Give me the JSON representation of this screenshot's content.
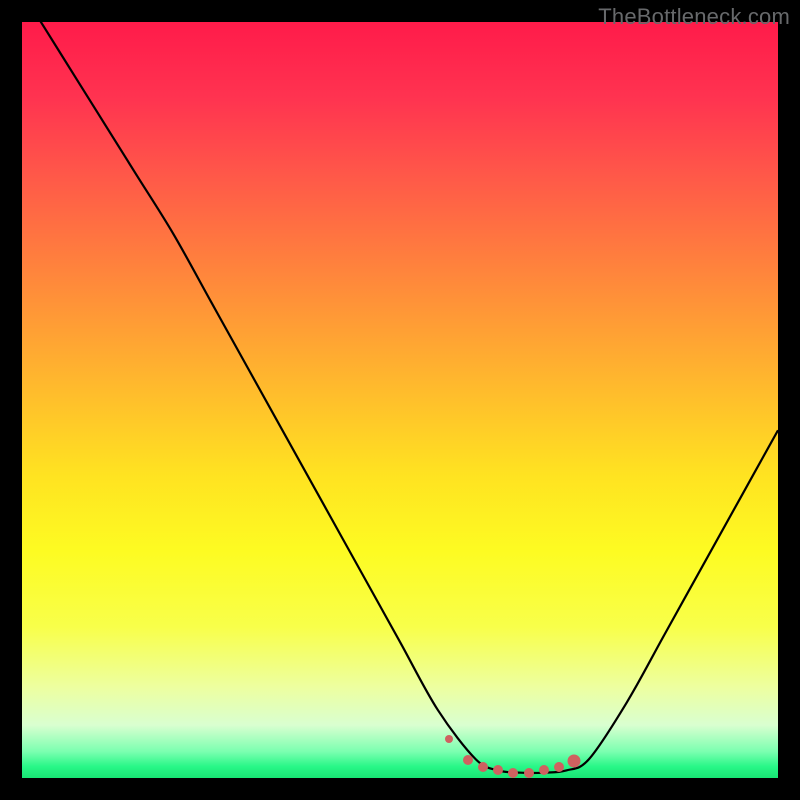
{
  "watermark": "TheBottleneck.com",
  "colors": {
    "background": "#000000",
    "curve": "#000000",
    "point": "#cf6160",
    "gradient_stops": [
      {
        "offset": 0.0,
        "color": "#ff1b4a"
      },
      {
        "offset": 0.1,
        "color": "#ff3350"
      },
      {
        "offset": 0.2,
        "color": "#ff5749"
      },
      {
        "offset": 0.3,
        "color": "#ff7a3f"
      },
      {
        "offset": 0.4,
        "color": "#ff9d35"
      },
      {
        "offset": 0.5,
        "color": "#ffc02b"
      },
      {
        "offset": 0.6,
        "color": "#ffe321"
      },
      {
        "offset": 0.7,
        "color": "#fdfb22"
      },
      {
        "offset": 0.8,
        "color": "#f8ff4a"
      },
      {
        "offset": 0.88,
        "color": "#edffa0"
      },
      {
        "offset": 0.93,
        "color": "#d9ffd0"
      },
      {
        "offset": 0.965,
        "color": "#7bffb0"
      },
      {
        "offset": 0.985,
        "color": "#28f787"
      },
      {
        "offset": 1.0,
        "color": "#18e574"
      }
    ]
  },
  "chart_data": {
    "type": "line",
    "title": "",
    "xlabel": "",
    "ylabel": "",
    "xlim": [
      0,
      100
    ],
    "ylim": [
      0,
      100
    ],
    "series": [
      {
        "name": "bottleneck-curve",
        "x": [
          0,
          5,
          10,
          15,
          20,
          25,
          30,
          35,
          40,
          45,
          50,
          55,
          60,
          63,
          66,
          69,
          72,
          75,
          80,
          85,
          90,
          95,
          100
        ],
        "y": [
          104,
          96,
          88,
          80,
          72,
          63,
          54,
          45,
          36,
          27,
          18,
          9,
          2.5,
          1.0,
          0.7,
          0.7,
          1.0,
          2.5,
          10.0,
          19.0,
          28.0,
          37.0,
          46.0
        ]
      }
    ],
    "highlight_points": {
      "name": "optimal-range",
      "color": "#cf6160",
      "x": [
        56.5,
        59,
        61,
        63,
        65,
        67,
        69,
        71,
        73
      ],
      "y": [
        5.2,
        2.4,
        1.5,
        1.0,
        0.7,
        0.7,
        1.0,
        1.5,
        2.3
      ]
    }
  }
}
